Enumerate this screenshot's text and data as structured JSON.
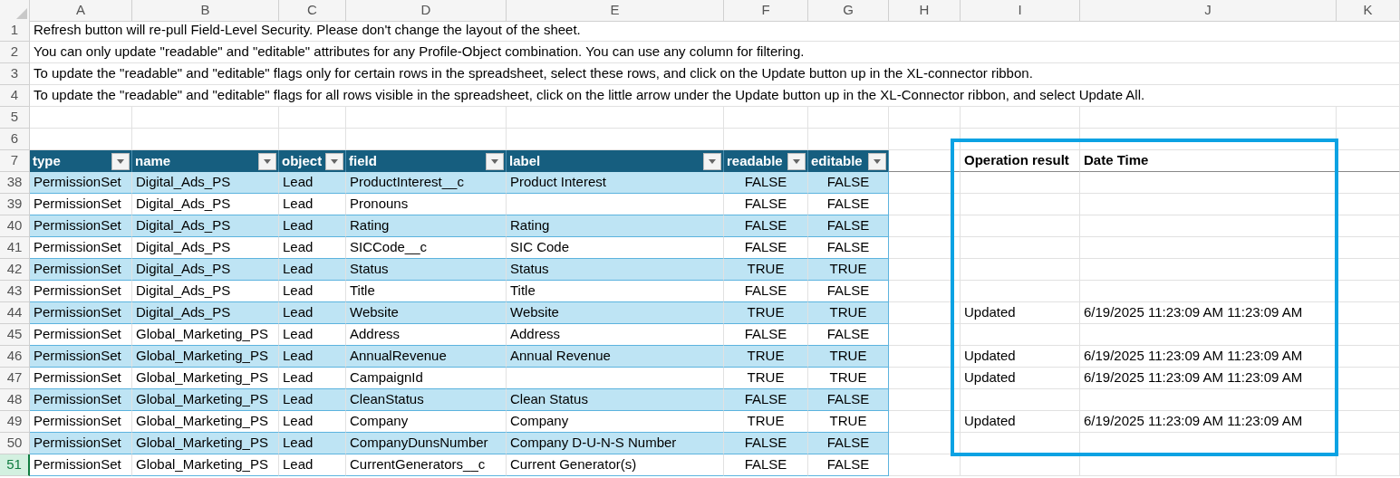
{
  "column_headers": [
    "A",
    "B",
    "C",
    "D",
    "E",
    "F",
    "G",
    "H",
    "I",
    "J",
    "K"
  ],
  "notes": [
    {
      "row": "1",
      "text": "Refresh button will re-pull Field-Level Security. Please don't change the layout of the sheet."
    },
    {
      "row": "2",
      "text": "You can only update \"readable\" and \"editable\" attributes for any Profile-Object combination. You can use any column for filtering."
    },
    {
      "row": "3",
      "text": "To update the \"readable\" and \"editable\" flags only for certain rows in the spreadsheet, select these rows, and click on the Update button up in the XL-connector ribbon."
    },
    {
      "row": "4",
      "text": "To update the \"readable\" and \"editable\" flags for all rows visible in the spreadsheet, click on the little arrow under the Update button up in the XL-Connector ribbon, and select Update All."
    }
  ],
  "empty_rows": [
    "5",
    "6"
  ],
  "table": {
    "header_row": "7",
    "columns": [
      "type",
      "name",
      "object",
      "field",
      "label",
      "readable",
      "editable"
    ],
    "result_columns": [
      "Operation result",
      "Date Time"
    ],
    "rows": [
      {
        "row": "38",
        "selected": false,
        "type": "PermissionSet",
        "name": "Digital_Ads_PS",
        "object": "Lead",
        "field": "ProductInterest__c",
        "label": "Product Interest",
        "readable": "FALSE",
        "editable": "FALSE"
      },
      {
        "row": "39",
        "selected": false,
        "type": "PermissionSet",
        "name": "Digital_Ads_PS",
        "object": "Lead",
        "field": "Pronouns",
        "readable": "FALSE",
        "editable": "FALSE"
      },
      {
        "row": "40",
        "selected": false,
        "type": "PermissionSet",
        "name": "Digital_Ads_PS",
        "object": "Lead",
        "field": "Rating",
        "label": "Rating",
        "readable": "FALSE",
        "editable": "FALSE"
      },
      {
        "row": "41",
        "selected": false,
        "type": "PermissionSet",
        "name": "Digital_Ads_PS",
        "object": "Lead",
        "field": "SICCode__c",
        "label": "SIC Code",
        "readable": "FALSE",
        "editable": "FALSE"
      },
      {
        "row": "42",
        "selected": false,
        "type": "PermissionSet",
        "name": "Digital_Ads_PS",
        "object": "Lead",
        "field": "Status",
        "label": "Status",
        "readable": "TRUE",
        "editable": "TRUE"
      },
      {
        "row": "43",
        "selected": false,
        "type": "PermissionSet",
        "name": "Digital_Ads_PS",
        "object": "Lead",
        "field": "Title",
        "label": "Title",
        "readable": "FALSE",
        "editable": "FALSE"
      },
      {
        "row": "44",
        "selected": false,
        "type": "PermissionSet",
        "name": "Digital_Ads_PS",
        "object": "Lead",
        "field": "Website",
        "label": "Website",
        "readable": "TRUE",
        "editable": "TRUE",
        "result": "Updated",
        "date_time": "6/19/2025 11:23:09 AM 11:23:09 AM"
      },
      {
        "row": "45",
        "selected": false,
        "type": "PermissionSet",
        "name": "Global_Marketing_PS",
        "object": "Lead",
        "field": "Address",
        "label": "Address",
        "readable": "FALSE",
        "editable": "FALSE"
      },
      {
        "row": "46",
        "selected": false,
        "type": "PermissionSet",
        "name": "Global_Marketing_PS",
        "object": "Lead",
        "field": "AnnualRevenue",
        "label": "Annual Revenue",
        "readable": "TRUE",
        "editable": "TRUE",
        "result": "Updated",
        "date_time": "6/19/2025 11:23:09 AM 11:23:09 AM"
      },
      {
        "row": "47",
        "selected": false,
        "type": "PermissionSet",
        "name": "Global_Marketing_PS",
        "object": "Lead",
        "field": "CampaignId",
        "readable": "TRUE",
        "editable": "TRUE",
        "result": "Updated",
        "date_time": "6/19/2025 11:23:09 AM 11:23:09 AM"
      },
      {
        "row": "48",
        "selected": false,
        "type": "PermissionSet",
        "name": "Global_Marketing_PS",
        "object": "Lead",
        "field": "CleanStatus",
        "label": "Clean Status",
        "readable": "FALSE",
        "editable": "FALSE"
      },
      {
        "row": "49",
        "selected": false,
        "type": "PermissionSet",
        "name": "Global_Marketing_PS",
        "object": "Lead",
        "field": "Company",
        "label": "Company",
        "readable": "TRUE",
        "editable": "TRUE",
        "result": "Updated",
        "date_time": "6/19/2025 11:23:09 AM 11:23:09 AM"
      },
      {
        "row": "50",
        "selected": false,
        "type": "PermissionSet",
        "name": "Global_Marketing_PS",
        "object": "Lead",
        "field": "CompanyDunsNumber",
        "label": "Company D-U-N-S Number",
        "readable": "FALSE",
        "editable": "FALSE"
      },
      {
        "row": "51",
        "selected": true,
        "type": "PermissionSet",
        "name": "Global_Marketing_PS",
        "object": "Lead",
        "field": "CurrentGenerators__c",
        "label": "Current Generator(s)",
        "readable": "FALSE",
        "editable": "FALSE"
      }
    ]
  }
}
